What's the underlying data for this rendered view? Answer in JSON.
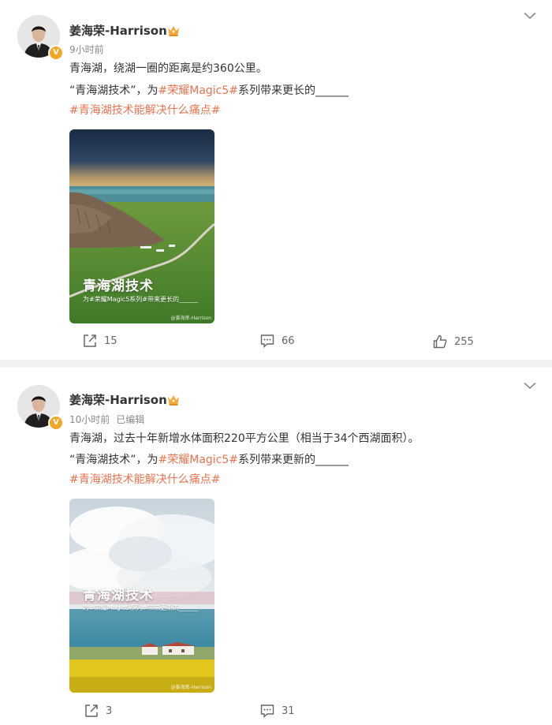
{
  "posts": [
    {
      "author": "姜海荣-Harrison",
      "verified_mark": "V",
      "time": "9小时前",
      "edited": "",
      "line1": "青海湖，绕湖一圈的距离是约360公里。",
      "line2_prefix": "“青海湖技术”，为",
      "line2_topic": "#荣耀Magic5#",
      "line2_suffix": "系列带来更长的______",
      "hashtag": "#青海湖技术能解决什么痛点#",
      "image": {
        "title": "青海湖技术",
        "subtitle": "为#荣耀Magic5系列#带来更长的______",
        "watermark": "@姜海荣-Harrison"
      },
      "actions": {
        "repost": "15",
        "comment": "66",
        "like": "255"
      }
    },
    {
      "author": "姜海荣-Harrison",
      "verified_mark": "V",
      "time": "10小时前",
      "edited": "已编辑",
      "line1": "青海湖，过去十年新增水体面积220平方公里（相当于34个西湖面积）。",
      "line2_prefix": "“青海湖技术”，为",
      "line2_topic": "#荣耀Magic5#",
      "line2_suffix": "系列带来更新的______",
      "hashtag": "#青海湖技术能解决什么痛点#",
      "image": {
        "title": "青海湖技术",
        "subtitle": "为#荣耀Magic5系列#带来更新的______",
        "watermark": "@姜海荣-Harrison"
      },
      "actions": {
        "repost": "3",
        "comment": "31"
      }
    }
  ],
  "icons": {
    "verified": "verified-badge-icon",
    "crown": "crown-icon",
    "more": "chevron-down-icon",
    "repost": "repost-icon",
    "comment": "comment-icon",
    "like": "thumbs-up-icon"
  },
  "colors": {
    "topic": "#eb7350",
    "verified": "#f5a623",
    "crown": "#f2a93b",
    "text": "#333333",
    "meta": "#8a8a8a",
    "separator": "#f2f2f2"
  }
}
